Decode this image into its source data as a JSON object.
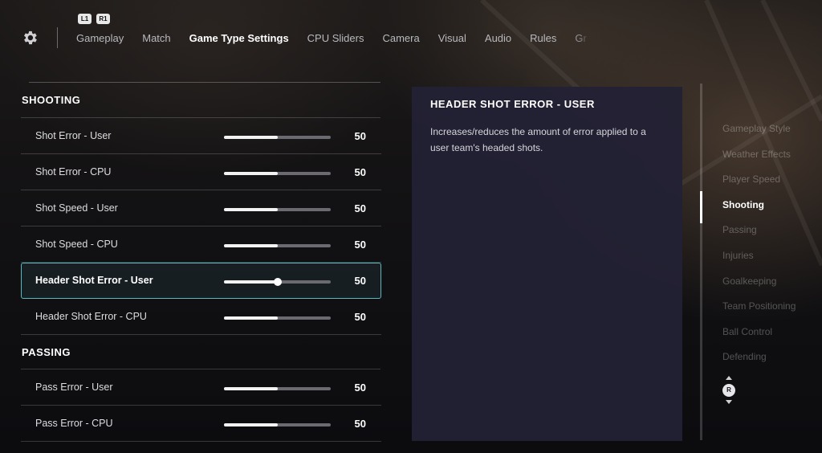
{
  "nav": {
    "hints": {
      "left": "L1",
      "right": "R1"
    },
    "tabs": [
      {
        "label": "Gameplay",
        "active": false
      },
      {
        "label": "Match",
        "active": false
      },
      {
        "label": "Game Type Settings",
        "active": true
      },
      {
        "label": "CPU Sliders",
        "active": false
      },
      {
        "label": "Camera",
        "active": false
      },
      {
        "label": "Visual",
        "active": false
      },
      {
        "label": "Audio",
        "active": false
      },
      {
        "label": "Rules",
        "active": false
      },
      {
        "label": "Gr",
        "active": false
      }
    ]
  },
  "sections": [
    {
      "title": "SHOOTING",
      "rows": [
        {
          "label": "Shot Error - User",
          "value": "50",
          "fraction": 0.5
        },
        {
          "label": "Shot Error - CPU",
          "value": "50",
          "fraction": 0.5
        },
        {
          "label": "Shot Speed - User",
          "value": "50",
          "fraction": 0.5
        },
        {
          "label": "Shot Speed - CPU",
          "value": "50",
          "fraction": 0.5
        },
        {
          "label": "Header Shot Error - User",
          "value": "50",
          "fraction": 0.5,
          "selected": true
        },
        {
          "label": "Header Shot Error - CPU",
          "value": "50",
          "fraction": 0.5
        }
      ]
    },
    {
      "title": "PASSING",
      "rows": [
        {
          "label": "Pass Error - User",
          "value": "50",
          "fraction": 0.5
        },
        {
          "label": "Pass Error - CPU",
          "value": "50",
          "fraction": 0.5
        }
      ]
    }
  ],
  "description": {
    "title": "HEADER SHOT ERROR - USER",
    "text": "Increases/reduces the amount of error applied to a user team's headed shots."
  },
  "index": {
    "items": [
      {
        "label": "Gameplay Style",
        "active": false
      },
      {
        "label": "Weather Effects",
        "active": false
      },
      {
        "label": "Player Speed",
        "active": false
      },
      {
        "label": "Shooting",
        "active": true
      },
      {
        "label": "Passing",
        "active": false
      },
      {
        "label": "Injuries",
        "active": false
      },
      {
        "label": "Goalkeeping",
        "active": false
      },
      {
        "label": "Team Positioning",
        "active": false
      },
      {
        "label": "Ball Control",
        "active": false
      },
      {
        "label": "Defending",
        "active": false
      }
    ],
    "scroll_button": "R"
  },
  "icons": {
    "settings": "gear-icon",
    "scroll": "right-stick-icon"
  },
  "colors": {
    "selection_border": "#5bb8bd",
    "panel_bg": "#222134",
    "slider_fill": "#f2f2f2",
    "slider_track": "#6a6a70"
  }
}
